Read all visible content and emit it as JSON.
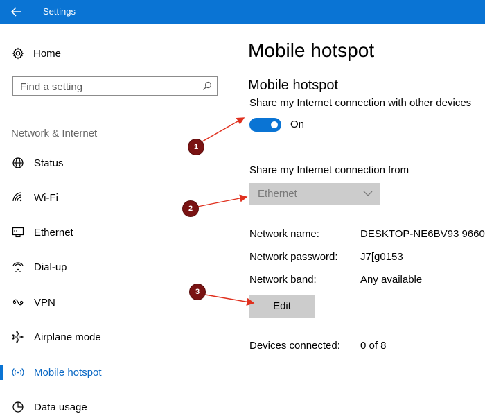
{
  "window": {
    "title": "Settings"
  },
  "sidebar": {
    "home_label": "Home",
    "search_placeholder": "Find a setting",
    "section_header": "Network & Internet",
    "items": [
      {
        "label": "Status",
        "icon": "globe-icon"
      },
      {
        "label": "Wi-Fi",
        "icon": "wifi-icon"
      },
      {
        "label": "Ethernet",
        "icon": "ethernet-icon"
      },
      {
        "label": "Dial-up",
        "icon": "dialup-icon"
      },
      {
        "label": "VPN",
        "icon": "vpn-icon"
      },
      {
        "label": "Airplane mode",
        "icon": "airplane-icon"
      },
      {
        "label": "Mobile hotspot",
        "icon": "hotspot-icon",
        "active": true
      },
      {
        "label": "Data usage",
        "icon": "data-usage-icon"
      }
    ]
  },
  "main": {
    "page_title": "Mobile hotspot",
    "section_title": "Mobile hotspot",
    "share_label": "Share my Internet connection with other devices",
    "toggle_state": "On",
    "share_from_label": "Share my Internet connection from",
    "share_from_value": "Ethernet",
    "network_name_label": "Network name:",
    "network_name_value": "DESKTOP-NE6BV93 9660",
    "network_password_label": "Network password:",
    "network_password_value": "J7[g0153",
    "network_band_label": "Network band:",
    "network_band_value": "Any available",
    "edit_button": "Edit",
    "devices_connected_label": "Devices connected:",
    "devices_connected_value": "0 of 8"
  },
  "annotations": [
    "1",
    "2",
    "3"
  ],
  "colors": {
    "accent": "#0a74d4",
    "annotation_badge": "#7a1313",
    "annotation_arrow": "#e0301e"
  }
}
